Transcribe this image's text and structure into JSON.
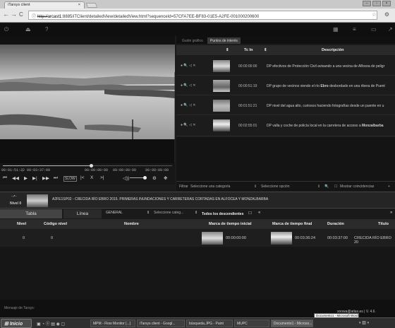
{
  "browser": {
    "tab_title": "iTarsys client",
    "tab_close": "×",
    "url_prefix": "ⓘ ",
    "url_scheme": "http://",
    "url_host": "arcast1",
    "url_rest": ":8885/iTClient/detailedView/detailedView.html?sequenceId=57CFA7EE-BF83-01E5-A2FE-001000200600"
  },
  "right_panel": {
    "tabs": [
      "Guión gráfico",
      "Puntos de interés"
    ],
    "active_tab": 1,
    "columns": {
      "tcin": "Tc In",
      "desc": "Descripción"
    },
    "rows": [
      {
        "tcin": "00:00:00:00",
        "desc": "DP efectivos de Protección Civil avisando a una vecina de Alfocea de peligr"
      },
      {
        "tcin": "00:00:51:19",
        "desc_pre": "DP grupo de vecinos viendo el río ",
        "desc_bold": "Ebro",
        "desc_post": " desbordado en una ribera de Puent"
      },
      {
        "tcin": "00:01:51:21",
        "desc": "DP nivel del agua alto, curiosos haciendo fotografías desde un puente en u"
      },
      {
        "tcin": "00:02:55:01",
        "desc_pre": "DP valla y coche de policía local en la carretera de acceso a ",
        "desc_bold": "Monzalbarba",
        "desc_post": ""
      }
    ],
    "filter": {
      "label": "Filtrar",
      "category_placeholder": "Seleccione una categoría",
      "option_placeholder": "Seleccione opción",
      "checkbox_label": "Mostrar coincidencias"
    }
  },
  "player": {
    "timecode_current": "00:01:51:22",
    "timecode_total": "00:03:37:00",
    "timecode_in": "00:00:00:00",
    "timecode_mark": "00:00:00:00",
    "timecode_out": "00:00:00:00",
    "speed": "SLOW",
    "progress": 0.52
  },
  "level_bar": {
    "arrow": "-↗-",
    "level_label": "Nivel 0",
    "title": "A2FE1SP02 - CRECIDA RÍO EBRO 2015. PRIMERAS INUNDACIONES Y CARRETERAS CORTADAS EN ALFOCEA Y MONZALBARBA"
  },
  "bottom": {
    "tabs": [
      "Tabla",
      "Línea"
    ],
    "general": "GENERAL",
    "select_category": "Seleccione categ...",
    "all_descendants": "Todos los descendientes",
    "columns": [
      "Nivel",
      "Código nivel",
      "Nombre",
      "Marca de tiempo inicial",
      "Marca de tiempo final",
      "Duración",
      "Título"
    ],
    "row": {
      "nivel": "0",
      "codigo": "0",
      "tc_start": "00:00:00:00",
      "tc_end": "00:03:36:24",
      "duration": "00:03:37:00",
      "title": "CRECIDA RÍO EBRO 20"
    }
  },
  "status": {
    "left": "Mensaje de Tarsys:",
    "right": "snowa@atlas.es | V. 4.6."
  },
  "taskbar": {
    "start": "Inicio",
    "items": [
      "MPM - Flow Monitor [...]",
      "iTarsys client - Googl...",
      "búsqueda.JPG - Paint",
      "MUPC",
      "Documento1 - Microso..."
    ],
    "tooltip": "Documento1 - Microsoft Word"
  }
}
